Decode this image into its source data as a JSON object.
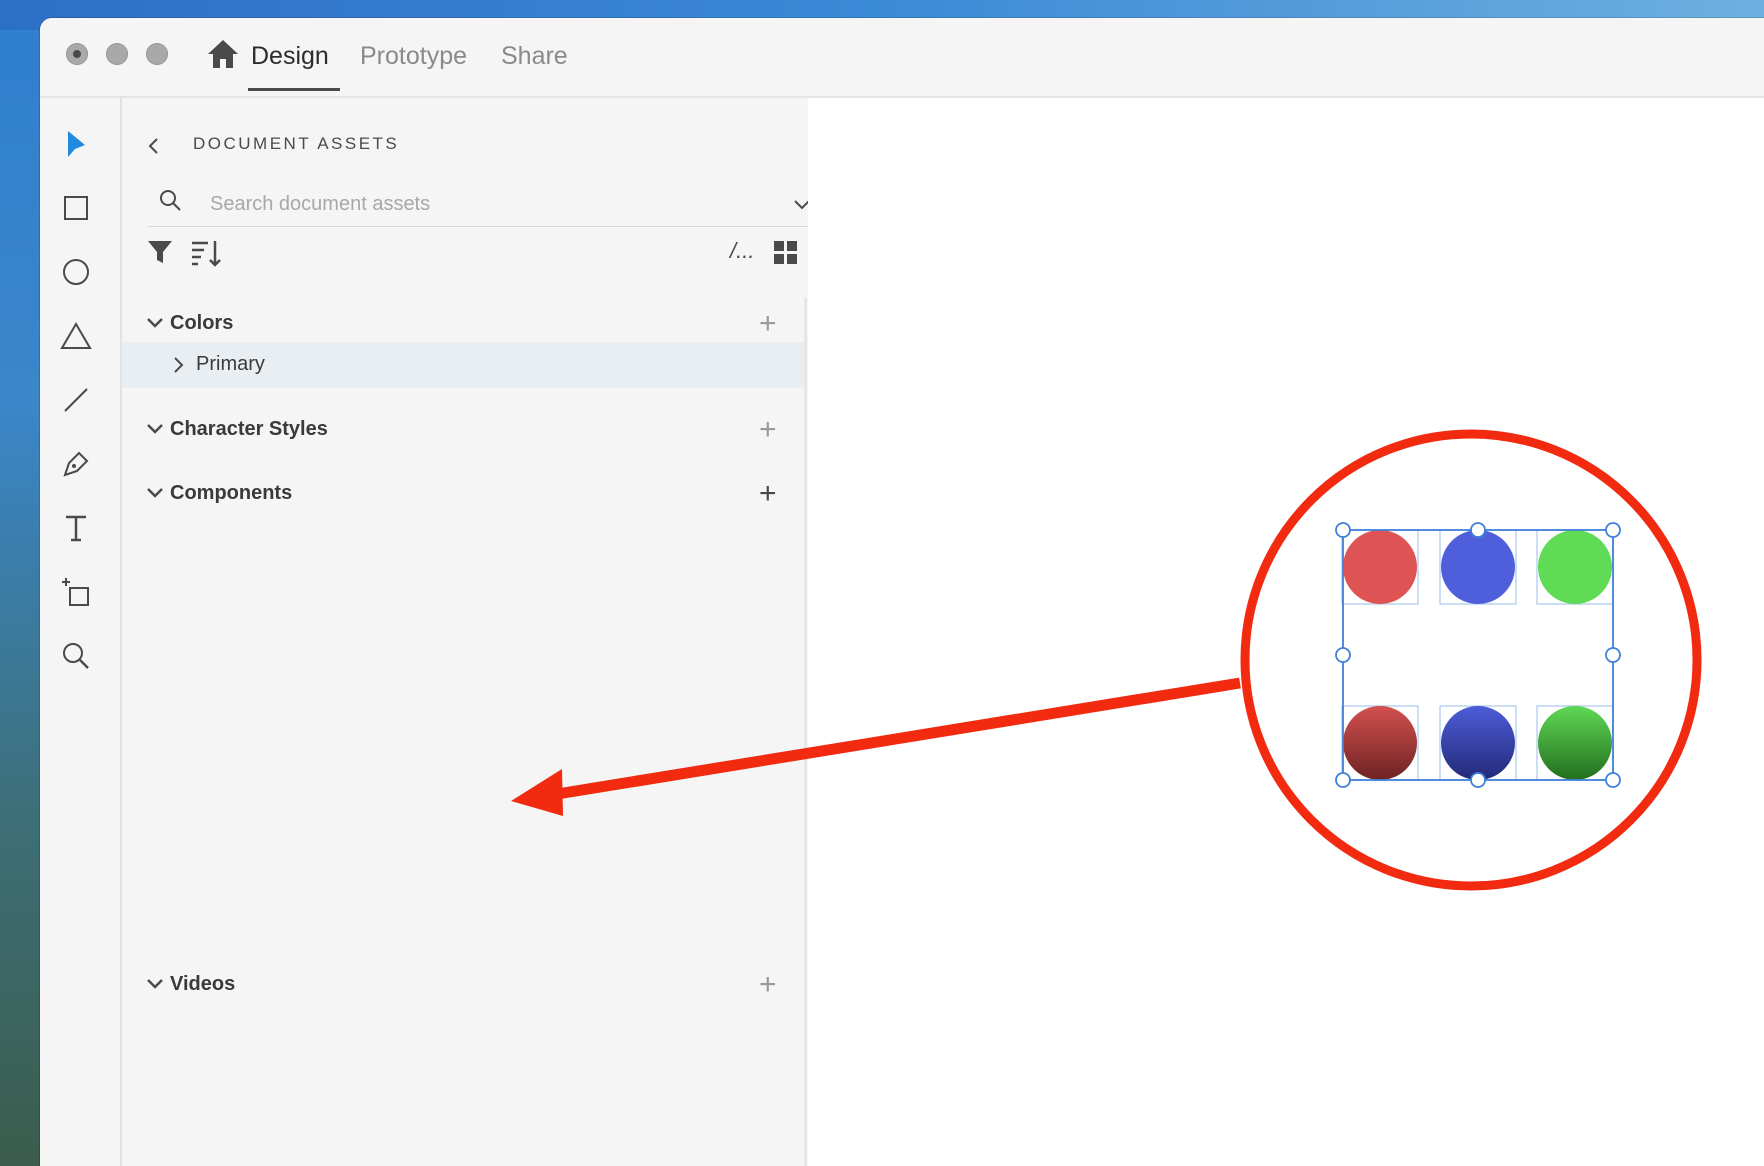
{
  "window": {
    "tabs": [
      {
        "label": "Design",
        "active": true
      },
      {
        "label": "Prototype",
        "active": false
      },
      {
        "label": "Share",
        "active": false
      }
    ]
  },
  "toolbar": {
    "tools": [
      "select-icon",
      "rectangle-icon",
      "ellipse-icon",
      "triangle-icon",
      "line-icon",
      "pen-icon",
      "text-icon",
      "artboard-icon",
      "zoom-icon"
    ]
  },
  "panel": {
    "title": "DOCUMENT ASSETS",
    "search": {
      "placeholder": "Search document assets",
      "value": ""
    },
    "sections": {
      "colors": {
        "label": "Colors",
        "sub_items": [
          {
            "label": "Primary"
          }
        ]
      },
      "character_styles": {
        "label": "Character Styles"
      },
      "components": {
        "label": "Components"
      },
      "videos": {
        "label": "Videos"
      }
    },
    "path_label": "/..."
  },
  "canvas": {
    "circle_colors": {
      "top": [
        "#de5454",
        "#4f5fdc",
        "#5fdb56"
      ],
      "bottom": [
        "#b03a3a",
        "#3a45b0",
        "#3aa533"
      ]
    },
    "selection_color": "#3f80d8",
    "annotation_color": "#f22a10"
  }
}
